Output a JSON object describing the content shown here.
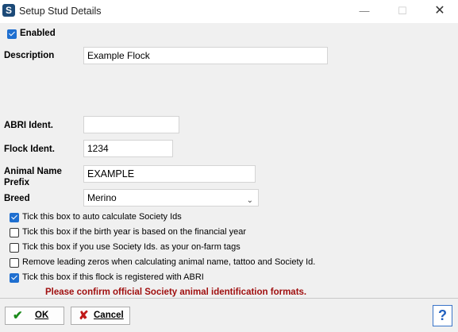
{
  "window": {
    "title": "Setup Stud Details",
    "minimize": "—",
    "maximize": "☐",
    "close": "✕"
  },
  "form": {
    "enabled_label": "Enabled",
    "enabled_checked": true,
    "description_label": "Description",
    "description_value": "Example Flock",
    "abri_label": "ABRI Ident.",
    "abri_value": "",
    "flock_label": "Flock Ident.",
    "flock_value": "1234",
    "prefix_label_line1": "Animal Name",
    "prefix_label_line2": "Prefix",
    "prefix_value": "EXAMPLE",
    "breed_label": "Breed",
    "breed_value": "Merino"
  },
  "options": [
    {
      "label": "Tick this box to auto calculate Society Ids",
      "checked": true
    },
    {
      "label": "Tick this box if the birth year is based on the financial year",
      "checked": false
    },
    {
      "label": "Tick this box if you use Society Ids. as your on-farm tags",
      "checked": false
    },
    {
      "label": "Remove leading zeros when calculating animal name, tattoo and Society Id.",
      "checked": false
    },
    {
      "label": "Tick this box if this flock is registered with ABRI",
      "checked": true
    }
  ],
  "warning": "Please confirm official Society animal identification formats.",
  "buttons": {
    "ok_label": "OK",
    "cancel_label": "Cancel",
    "help_label": "?"
  },
  "colors": {
    "accent": "#1f6fd0",
    "warning": "#a01010",
    "client_bg": "#f0f0f0"
  }
}
